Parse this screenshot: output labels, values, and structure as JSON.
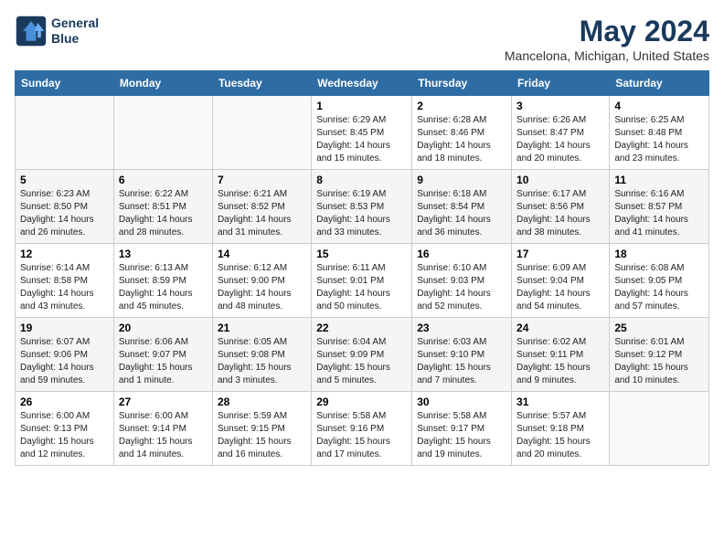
{
  "header": {
    "logo_line1": "General",
    "logo_line2": "Blue",
    "month": "May 2024",
    "location": "Mancelona, Michigan, United States"
  },
  "weekdays": [
    "Sunday",
    "Monday",
    "Tuesday",
    "Wednesday",
    "Thursday",
    "Friday",
    "Saturday"
  ],
  "weeks": [
    [
      {
        "day": "",
        "content": ""
      },
      {
        "day": "",
        "content": ""
      },
      {
        "day": "",
        "content": ""
      },
      {
        "day": "1",
        "content": "Sunrise: 6:29 AM\nSunset: 8:45 PM\nDaylight: 14 hours\nand 15 minutes."
      },
      {
        "day": "2",
        "content": "Sunrise: 6:28 AM\nSunset: 8:46 PM\nDaylight: 14 hours\nand 18 minutes."
      },
      {
        "day": "3",
        "content": "Sunrise: 6:26 AM\nSunset: 8:47 PM\nDaylight: 14 hours\nand 20 minutes."
      },
      {
        "day": "4",
        "content": "Sunrise: 6:25 AM\nSunset: 8:48 PM\nDaylight: 14 hours\nand 23 minutes."
      }
    ],
    [
      {
        "day": "5",
        "content": "Sunrise: 6:23 AM\nSunset: 8:50 PM\nDaylight: 14 hours\nand 26 minutes."
      },
      {
        "day": "6",
        "content": "Sunrise: 6:22 AM\nSunset: 8:51 PM\nDaylight: 14 hours\nand 28 minutes."
      },
      {
        "day": "7",
        "content": "Sunrise: 6:21 AM\nSunset: 8:52 PM\nDaylight: 14 hours\nand 31 minutes."
      },
      {
        "day": "8",
        "content": "Sunrise: 6:19 AM\nSunset: 8:53 PM\nDaylight: 14 hours\nand 33 minutes."
      },
      {
        "day": "9",
        "content": "Sunrise: 6:18 AM\nSunset: 8:54 PM\nDaylight: 14 hours\nand 36 minutes."
      },
      {
        "day": "10",
        "content": "Sunrise: 6:17 AM\nSunset: 8:56 PM\nDaylight: 14 hours\nand 38 minutes."
      },
      {
        "day": "11",
        "content": "Sunrise: 6:16 AM\nSunset: 8:57 PM\nDaylight: 14 hours\nand 41 minutes."
      }
    ],
    [
      {
        "day": "12",
        "content": "Sunrise: 6:14 AM\nSunset: 8:58 PM\nDaylight: 14 hours\nand 43 minutes."
      },
      {
        "day": "13",
        "content": "Sunrise: 6:13 AM\nSunset: 8:59 PM\nDaylight: 14 hours\nand 45 minutes."
      },
      {
        "day": "14",
        "content": "Sunrise: 6:12 AM\nSunset: 9:00 PM\nDaylight: 14 hours\nand 48 minutes."
      },
      {
        "day": "15",
        "content": "Sunrise: 6:11 AM\nSunset: 9:01 PM\nDaylight: 14 hours\nand 50 minutes."
      },
      {
        "day": "16",
        "content": "Sunrise: 6:10 AM\nSunset: 9:03 PM\nDaylight: 14 hours\nand 52 minutes."
      },
      {
        "day": "17",
        "content": "Sunrise: 6:09 AM\nSunset: 9:04 PM\nDaylight: 14 hours\nand 54 minutes."
      },
      {
        "day": "18",
        "content": "Sunrise: 6:08 AM\nSunset: 9:05 PM\nDaylight: 14 hours\nand 57 minutes."
      }
    ],
    [
      {
        "day": "19",
        "content": "Sunrise: 6:07 AM\nSunset: 9:06 PM\nDaylight: 14 hours\nand 59 minutes."
      },
      {
        "day": "20",
        "content": "Sunrise: 6:06 AM\nSunset: 9:07 PM\nDaylight: 15 hours\nand 1 minute."
      },
      {
        "day": "21",
        "content": "Sunrise: 6:05 AM\nSunset: 9:08 PM\nDaylight: 15 hours\nand 3 minutes."
      },
      {
        "day": "22",
        "content": "Sunrise: 6:04 AM\nSunset: 9:09 PM\nDaylight: 15 hours\nand 5 minutes."
      },
      {
        "day": "23",
        "content": "Sunrise: 6:03 AM\nSunset: 9:10 PM\nDaylight: 15 hours\nand 7 minutes."
      },
      {
        "day": "24",
        "content": "Sunrise: 6:02 AM\nSunset: 9:11 PM\nDaylight: 15 hours\nand 9 minutes."
      },
      {
        "day": "25",
        "content": "Sunrise: 6:01 AM\nSunset: 9:12 PM\nDaylight: 15 hours\nand 10 minutes."
      }
    ],
    [
      {
        "day": "26",
        "content": "Sunrise: 6:00 AM\nSunset: 9:13 PM\nDaylight: 15 hours\nand 12 minutes."
      },
      {
        "day": "27",
        "content": "Sunrise: 6:00 AM\nSunset: 9:14 PM\nDaylight: 15 hours\nand 14 minutes."
      },
      {
        "day": "28",
        "content": "Sunrise: 5:59 AM\nSunset: 9:15 PM\nDaylight: 15 hours\nand 16 minutes."
      },
      {
        "day": "29",
        "content": "Sunrise: 5:58 AM\nSunset: 9:16 PM\nDaylight: 15 hours\nand 17 minutes."
      },
      {
        "day": "30",
        "content": "Sunrise: 5:58 AM\nSunset: 9:17 PM\nDaylight: 15 hours\nand 19 minutes."
      },
      {
        "day": "31",
        "content": "Sunrise: 5:57 AM\nSunset: 9:18 PM\nDaylight: 15 hours\nand 20 minutes."
      },
      {
        "day": "",
        "content": ""
      }
    ]
  ]
}
